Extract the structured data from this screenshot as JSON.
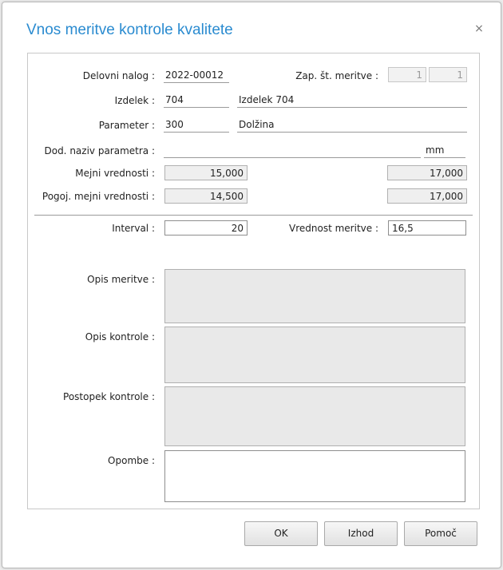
{
  "dialog": {
    "title": "Vnos meritve kontrole kvalitete",
    "close_icon": "×"
  },
  "form": {
    "delovni_nalog_label": "Delovni nalog :",
    "delovni_nalog_value": "2022-00012",
    "zap_st_label": "Zap. št. meritve :",
    "zap_st_value_1": "1",
    "zap_st_value_2": "1",
    "izdelek_label": "Izdelek :",
    "izdelek_code": "704",
    "izdelek_name": "Izdelek 704",
    "parameter_label": "Parameter :",
    "parameter_code": "300",
    "parameter_name": "Dolžina",
    "dod_naziv_label": "Dod. naziv parametra :",
    "dod_naziv_value": "",
    "unit": "mm",
    "mejni_label": "Mejni vrednosti :",
    "mejni_min": "15,000",
    "mejni_max": "17,000",
    "pogoj_label": "Pogoj. mejni vrednosti :",
    "pogoj_min": "14,500",
    "pogoj_max": "17,000",
    "interval_label": "Interval :",
    "interval_value": "20",
    "vrednost_label": "Vrednost meritve :",
    "vrednost_value": "16,5",
    "opis_meritve_label": "Opis meritve :",
    "opis_kontrole_label": "Opis kontrole :",
    "postopek_label": "Postopek kontrole :",
    "opombe_label": "Opombe :"
  },
  "buttons": {
    "ok": "OK",
    "izhod": "Izhod",
    "pomoc": "Pomoč"
  }
}
